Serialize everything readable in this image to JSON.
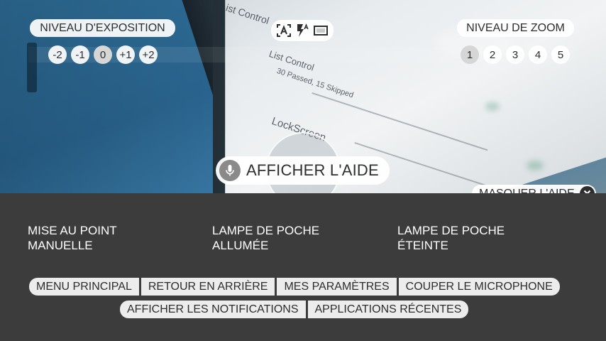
{
  "exposure": {
    "label": "NIVEAU D'EXPOSITION",
    "levels": [
      "-2",
      "-1",
      "0",
      "+1",
      "+2"
    ],
    "selected": "0"
  },
  "zoom": {
    "label": "NIVEAU DE ZOOM",
    "levels": [
      "1",
      "2",
      "3",
      "4",
      "5"
    ],
    "selected": "1"
  },
  "modes": {
    "icons": [
      "auto-focus-icon",
      "flash-auto-icon",
      "aspect-ratio-icon"
    ]
  },
  "help_button": {
    "label": "AFFICHER L'AIDE",
    "icon": "microphone-icon"
  },
  "hide_help": {
    "label": "MASQUER L'AIDE",
    "icon": "close-icon"
  },
  "voice_commands": [
    {
      "label": "MISE AU POINT MANUELLE"
    },
    {
      "label": "LAMPE DE POCHE ALLUMÉE"
    },
    {
      "label": "LAMPE DE POCHE ÉTEINTE"
    }
  ],
  "global_commands_row1": [
    "MENU PRINCIPAL",
    "RETOUR EN ARRIÈRE",
    "MES PARAMÈTRES",
    "COUPER LE MICROPHONE"
  ],
  "global_commands_row2": [
    "AFFICHER LES NOTIFICATIONS",
    "APPLICATIONS RÉCENTES"
  ],
  "viewfinder_text": {
    "line1": "List Control",
    "line2": "List Control",
    "line3": "30 Passed, 15 Skipped",
    "line4": "LockScreen"
  },
  "colors": {
    "panel_bg": "#3c3c3c",
    "pill_bg": "#ffffff",
    "text_dark": "#2d2d2d",
    "mic_circle": "#8a8a8a"
  }
}
